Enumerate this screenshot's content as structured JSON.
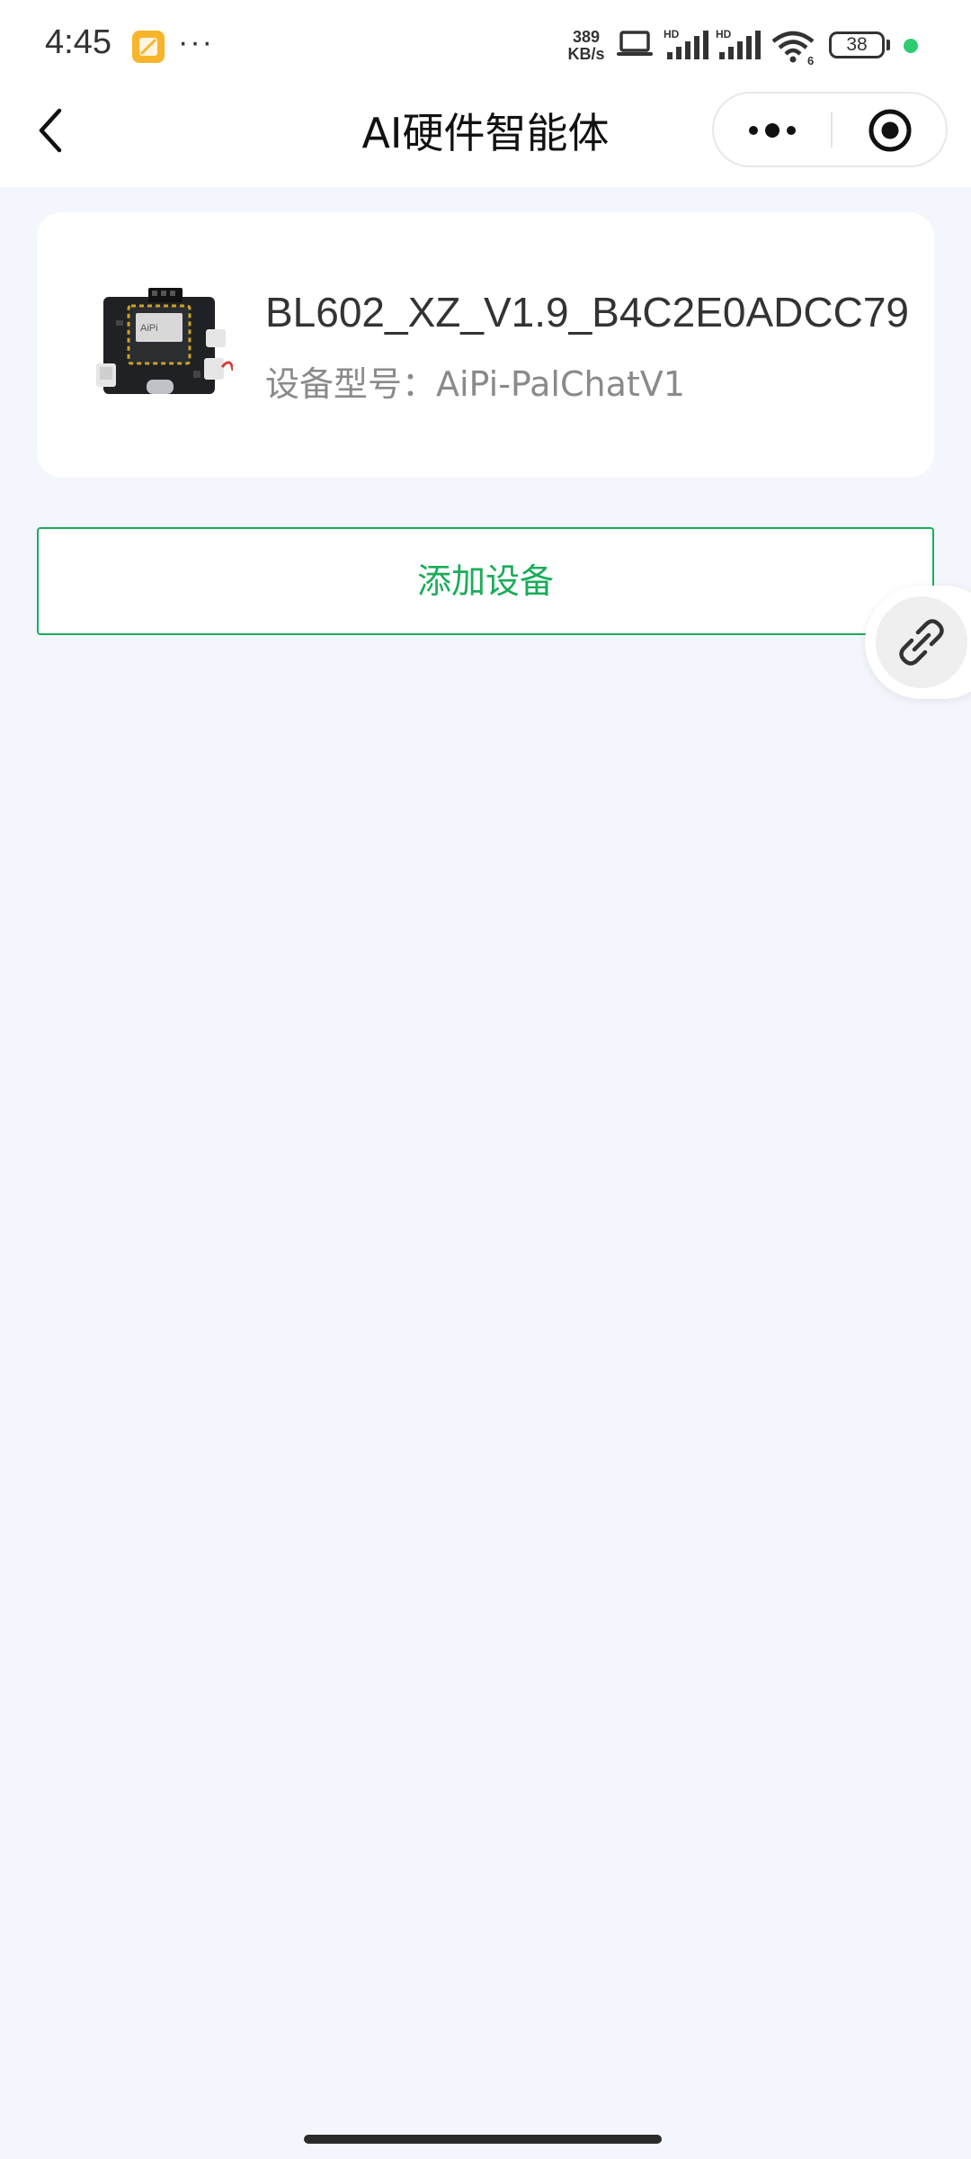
{
  "status_bar": {
    "time": "4:45",
    "more": "···",
    "speed_value": "389",
    "speed_unit": "KB/s",
    "battery": "38",
    "icons": [
      "app-notification-icon",
      "laptop-icon",
      "hd-signal-icon",
      "hd-signal-icon",
      "wifi-6-icon",
      "battery-icon"
    ]
  },
  "header": {
    "title": "AI硬件智能体",
    "back_icon": "chevron-left-icon",
    "more_icon": "more-dots-icon",
    "close_icon": "target-close-icon"
  },
  "device": {
    "name": "BL602_XZ_V1.9_B4C2E0ADCC79",
    "model": "设备型号：AiPi-PalChatV1",
    "image_icon": "dev-board-image"
  },
  "actions": {
    "add_device": "添加设备"
  },
  "floating": {
    "icon": "link-icon"
  },
  "colors": {
    "accent_green": "#1aad5a",
    "page_background": "#f3f6fc",
    "status_dot": "#2ecc71"
  }
}
